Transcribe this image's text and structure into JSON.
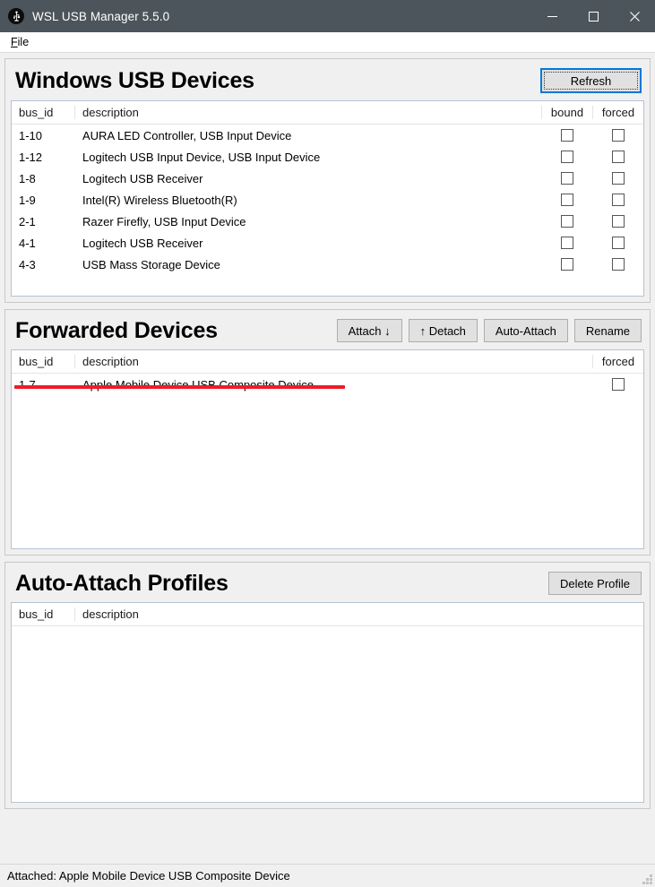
{
  "window": {
    "title": "WSL USB Manager 5.5.0",
    "icon": "usb-icon",
    "controls": {
      "minimize": "minimize-icon",
      "maximize": "maximize-icon",
      "close": "close-icon"
    }
  },
  "menubar": {
    "items": [
      {
        "label": "File",
        "mnemonic": "F",
        "rest": "ile"
      }
    ]
  },
  "panels": {
    "windows_devices": {
      "title": "Windows USB Devices",
      "refresh_label": "Refresh",
      "columns": [
        "bus_id",
        "description",
        "bound",
        "forced"
      ],
      "rows": [
        {
          "bus_id": "1-10",
          "description": "AURA LED Controller, USB Input Device",
          "bound": false,
          "forced": false
        },
        {
          "bus_id": "1-12",
          "description": "Logitech USB Input Device, USB Input Device",
          "bound": false,
          "forced": false
        },
        {
          "bus_id": "1-8",
          "description": "Logitech USB Receiver",
          "bound": false,
          "forced": false
        },
        {
          "bus_id": "1-9",
          "description": "Intel(R) Wireless Bluetooth(R)",
          "bound": false,
          "forced": false
        },
        {
          "bus_id": "2-1",
          "description": "Razer Firefly, USB Input Device",
          "bound": false,
          "forced": false
        },
        {
          "bus_id": "4-1",
          "description": "Logitech USB Receiver",
          "bound": false,
          "forced": false
        },
        {
          "bus_id": "4-3",
          "description": "USB Mass Storage Device",
          "bound": false,
          "forced": false
        }
      ]
    },
    "forwarded_devices": {
      "title": "Forwarded Devices",
      "buttons": [
        {
          "label": "Attach ↓",
          "name": "attach-button"
        },
        {
          "label": "↑ Detach",
          "name": "detach-button"
        },
        {
          "label": "Auto-Attach",
          "name": "auto-attach-button"
        },
        {
          "label": "Rename",
          "name": "rename-button"
        }
      ],
      "columns": [
        "bus_id",
        "description",
        "forced"
      ],
      "rows": [
        {
          "bus_id": "1-7",
          "description": "Apple Mobile Device USB Composite Device",
          "forced": false
        }
      ],
      "annotation_color": "#ee1c25"
    },
    "auto_attach_profiles": {
      "title": "Auto-Attach Profiles",
      "delete_label": "Delete Profile",
      "columns": [
        "bus_id",
        "description"
      ],
      "rows": []
    }
  },
  "statusbar": {
    "text": "Attached: Apple Mobile Device USB Composite Device"
  },
  "colors": {
    "titlebar": "#4c555b",
    "accent_focus": "#0078d7",
    "annotation": "#ee1c25",
    "panel_bg": "#f0f0f0",
    "table_bg": "#ffffff"
  }
}
